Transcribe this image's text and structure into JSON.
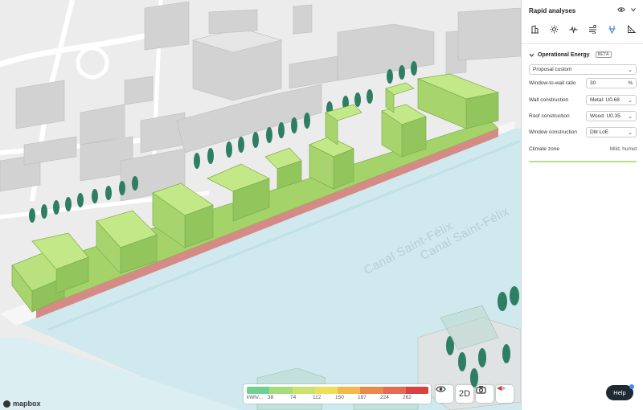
{
  "panel": {
    "title": "Rapid analyses",
    "tools": [
      "building-icon",
      "sun-icon",
      "wind-icon",
      "airflow-icon",
      "energy-icon",
      "slope-icon"
    ],
    "section_title": "Operational Energy",
    "beta_badge": "BETA",
    "proposal_select": "Proposal custom",
    "rows": [
      {
        "label": "Window-to-wall ratio",
        "value": "30",
        "unit": "%"
      },
      {
        "label": "Wall construction",
        "value": "Metal: U0.68"
      },
      {
        "label": "Roof construction",
        "value": "Wood: U0.35"
      },
      {
        "label": "Window construction",
        "value": "Dbl LoE"
      }
    ],
    "climate_label": "Climate zone",
    "climate_value": "Mild, humid"
  },
  "map": {
    "canal_label_1": "Canal Saint-Félix",
    "canal_label_2": "Canal Saint-Félix",
    "attribution": "mapbox"
  },
  "legend": {
    "unit": "kWh/...",
    "ticks": [
      "38",
      "74",
      "112",
      "150",
      "187",
      "224",
      "262"
    ],
    "colors": [
      "#6fd08f",
      "#a6dc7c",
      "#c9e36e",
      "#ecdf5a",
      "#f2b94c",
      "#e98a4c",
      "#e36a55",
      "#d8423f"
    ]
  },
  "controls": {
    "view_2d": "2D"
  },
  "help_label": "Help"
}
